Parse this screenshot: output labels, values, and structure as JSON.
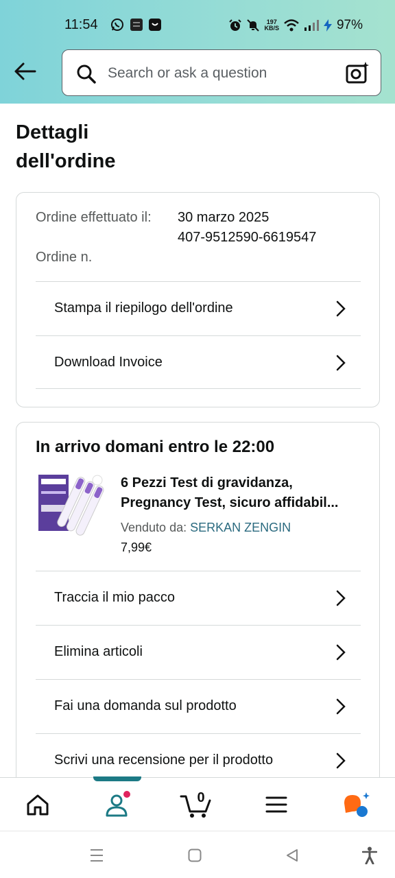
{
  "status_bar": {
    "time": "11:54",
    "speed_value": "197",
    "speed_unit": "KB/S",
    "battery": "97%"
  },
  "search": {
    "placeholder": "Search or ask a question"
  },
  "page": {
    "title": "Dettagli dell'ordine"
  },
  "order_info": {
    "date_label": "Ordine effettuato il:",
    "date_value": "30 marzo 2025",
    "number_label": "Ordine n.",
    "number_value": "407-9512590-6619547"
  },
  "order_actions": [
    {
      "label": "Stampa il riepilogo dell'ordine"
    },
    {
      "label": "Download Invoice"
    }
  ],
  "shipment": {
    "arrival": "In arrivo domani entro le 22:00",
    "product_title_line1": "6 Pezzi Test di gravidanza,",
    "product_title_line2": "Pregnancy Test, sicuro affidabil...",
    "seller_label": "Venduto da:",
    "seller_name": "SERKAN ZENGIN",
    "price": "7,99€"
  },
  "shipment_actions": [
    {
      "label": "Traccia il mio pacco"
    },
    {
      "label": "Elimina articoli"
    },
    {
      "label": "Fai una domanda sul prodotto"
    },
    {
      "label": "Scrivi una recensione per il prodotto"
    }
  ],
  "bottom_nav": {
    "cart_count": "0",
    "items": [
      "home-icon",
      "account-icon",
      "cart-icon",
      "menu-icon",
      "rufus-icon"
    ],
    "accent_color": "#1c7a85",
    "notification_color": "#e0245e"
  },
  "colors": {
    "header_gradient_start": "#7fd3d9",
    "header_gradient_end": "#a5e2cf",
    "link": "#2a6a7f"
  }
}
